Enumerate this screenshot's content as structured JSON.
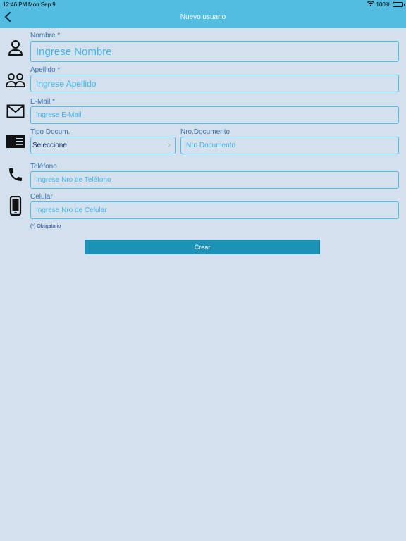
{
  "status_bar": {
    "time": "12:46 PM",
    "date": "Mon Sep 9",
    "battery": "100%"
  },
  "nav": {
    "title": "Nuevo usuario",
    "back_icon": "chevron-left-icon"
  },
  "form": {
    "nombre": {
      "label": "Nombre *",
      "placeholder": "Ingrese Nombre",
      "icon": "person-icon"
    },
    "apellido": {
      "label": "Apellido *",
      "placeholder": "Ingrese Apellido",
      "icon": "people-icon"
    },
    "email": {
      "label": "E-Mail *",
      "placeholder": "Ingrese E-Mail",
      "icon": "mail-icon"
    },
    "tipo_documento": {
      "label": "Tipo Docum.",
      "value": "Seleccione",
      "icon": "id-card-icon"
    },
    "nro_documento": {
      "label": "Nro.Documento",
      "placeholder": "Nro Documento"
    },
    "telefono": {
      "label": "Teléfono",
      "placeholder": "Ingrese Nro de Teléfono",
      "icon": "phone-icon"
    },
    "celular": {
      "label": "Celular",
      "placeholder": "Ingrese Nro de Celular",
      "icon": "mobile-icon"
    },
    "required_note": "(*) Obligatorio",
    "submit_label": "Crear"
  },
  "colors": {
    "nav_bar": "#52bde0",
    "background": "#d3e1ef",
    "input_border": "#4bbde6",
    "button": "#1b92b6"
  }
}
